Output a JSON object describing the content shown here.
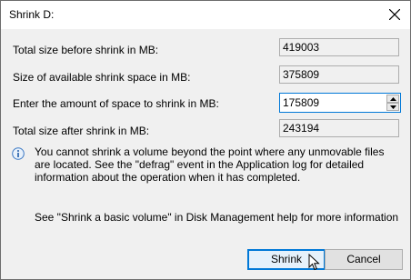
{
  "window": {
    "title": "Shrink D:",
    "close_icon": "close-icon"
  },
  "fields": {
    "total_before": {
      "label": "Total size before shrink in MB:",
      "value": "419003"
    },
    "available": {
      "label": "Size of available shrink space in MB:",
      "value": "375809"
    },
    "amount": {
      "label": "Enter the amount of space to shrink in MB:",
      "value": "175809"
    },
    "total_after": {
      "label": "Total size after shrink in MB:",
      "value": "243194"
    }
  },
  "info": {
    "icon": "info-icon",
    "text": "You cannot shrink a volume beyond the point where any unmovable files are located. See the \"defrag\" event in the Application log for detailed information about the operation when it has completed."
  },
  "help": {
    "text": "See \"Shrink a basic volume\" in Disk Management help for more information"
  },
  "buttons": {
    "shrink": "Shrink",
    "cancel": "Cancel"
  },
  "colors": {
    "accent": "#0078d7",
    "dialog_bg": "#f0f0f0"
  }
}
